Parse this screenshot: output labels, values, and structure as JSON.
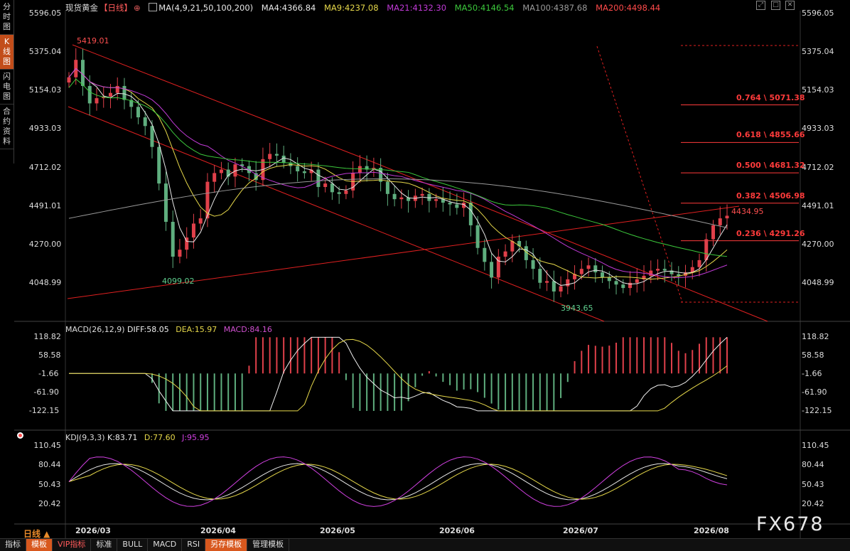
{
  "side_tabs": [
    {
      "label": "分时图",
      "active": false
    },
    {
      "label": "K线图",
      "active": true
    },
    {
      "label": "闪电图",
      "active": false
    },
    {
      "label": "合约资料",
      "active": false
    }
  ],
  "legend": {
    "symbol": "现货黄金",
    "period": "【日线】",
    "ma_set": "MA(4,9,21,50,100,200)",
    "ma4": "MA4:4366.84",
    "ma9": "MA9:4237.08",
    "ma21": "MA21:4132.30",
    "ma50": "MA50:4146.54",
    "ma100": "MA100:4387.68",
    "ma200": "MA200:4498.44"
  },
  "price_axis": [
    "5596.05",
    "5375.04",
    "5154.03",
    "4933.03",
    "4712.02",
    "4491.01",
    "4270.00",
    "4048.99"
  ],
  "price_labels": {
    "high": "5419.01",
    "low1": "4099.02",
    "low2": "3943.65",
    "last": "4434.95"
  },
  "fib_levels": [
    {
      "label": "0.764 \\ 5071.38",
      "value": 5071.38
    },
    {
      "label": "0.618 \\ 4855.66",
      "value": 4855.66
    },
    {
      "label": "0.500 \\ 4681.32",
      "value": 4681.32
    },
    {
      "label": "0.382 \\ 4506.98",
      "value": 4506.98
    },
    {
      "label": "0.236 \\ 4291.26",
      "value": 4291.26
    }
  ],
  "macd": {
    "title": "MACD(26,12,9)",
    "diff": "DIFF:58.05",
    "dea": "DEA:15.97",
    "macd": "MACD:84.16",
    "axis": [
      "118.82",
      "58.58",
      "-1.66",
      "-61.90",
      "-122.15"
    ]
  },
  "kdj": {
    "title": "KDJ(9,3,3)",
    "k": "K:83.71",
    "d": "D:77.60",
    "j": "J:95.95",
    "axis": [
      "110.45",
      "80.44",
      "50.43",
      "20.42"
    ]
  },
  "range_label": "日线 ▲",
  "dates": [
    "2026/03",
    "2026/04",
    "2026/05",
    "2026/06",
    "2026/07",
    "2026/08"
  ],
  "bottom_tabs": [
    {
      "label": "指标",
      "style": "normal"
    },
    {
      "label": "模板",
      "style": "active"
    },
    {
      "label": "VIP指标",
      "style": "vip"
    },
    {
      "label": "标准",
      "style": "normal"
    },
    {
      "label": "BULL",
      "style": "normal"
    },
    {
      "label": "MACD",
      "style": "normal"
    },
    {
      "label": "RSI",
      "style": "normal"
    },
    {
      "label": "另存模板",
      "style": "active"
    },
    {
      "label": "管理模板",
      "style": "normal"
    }
  ],
  "watermark": "FX678",
  "colors": {
    "bull": "#e0404a",
    "bear": "#5fae7e",
    "ma4": "#e8e8e8",
    "ma9": "#e6d84a",
    "ma21": "#c03ad6",
    "ma50": "#3cc93c",
    "ma100": "#9a9a9a",
    "ma200": "#ff4a4a",
    "fib": "#ff3b3b",
    "diff": "#f0f0f0",
    "dea": "#e6d84a",
    "macd": "#d050d0",
    "kdj_j": "#d040e0"
  }
}
